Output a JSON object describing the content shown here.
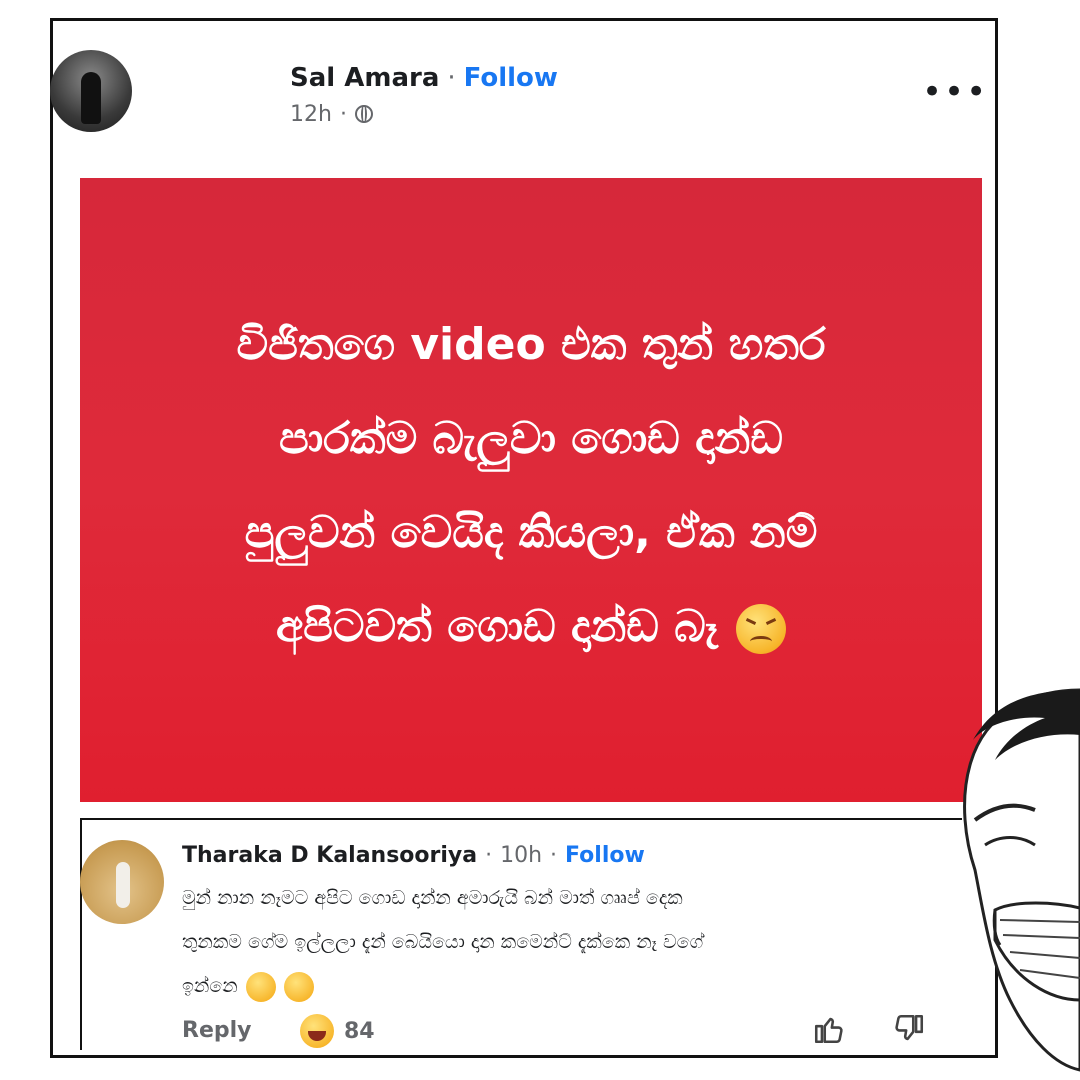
{
  "post": {
    "author": "Sal Amara",
    "separator": "·",
    "follow": "Follow",
    "time": "12h",
    "time_sep": "·",
    "more": "•••",
    "card_lines": [
      "විජිතගෙ video එක තුන් හතර",
      "පාරක්ම බැලුවා ගොඩ දාන්ඩ",
      "පුලුවන් වෙයිද කියලා, ඒක නම්",
      "අපිටවත් ගොඩ දාන්ඩ බෑ"
    ],
    "card_emoji": "confounded-face-emoji"
  },
  "comment": {
    "name": "Tharaka D Kalansooriya",
    "sep1": "·",
    "time": "10h",
    "sep2": "·",
    "follow": "Follow",
    "lines": [
      "මුන් නාන නෑමට අපිට ගොඩ දාන්න අමාරුයි බන් මාත් ගෲප් දෙක",
      "තුනකම ගේම ඉල්ලලා දැන් බෙයියො දාන කමෙන්ට් දැක්කෙ නෑ වගේ",
      "ඉන්නෙ"
    ],
    "emojis": [
      "pleading-face-emoji",
      "face-with-hand-over-mouth-emoji"
    ],
    "reply": "Reply",
    "reaction_emoji": "laughing-face-emoji",
    "reaction_count": "84"
  },
  "colors": {
    "card_red": "#df2a3a",
    "link_blue": "#1877f2",
    "muted": "#65676b"
  }
}
